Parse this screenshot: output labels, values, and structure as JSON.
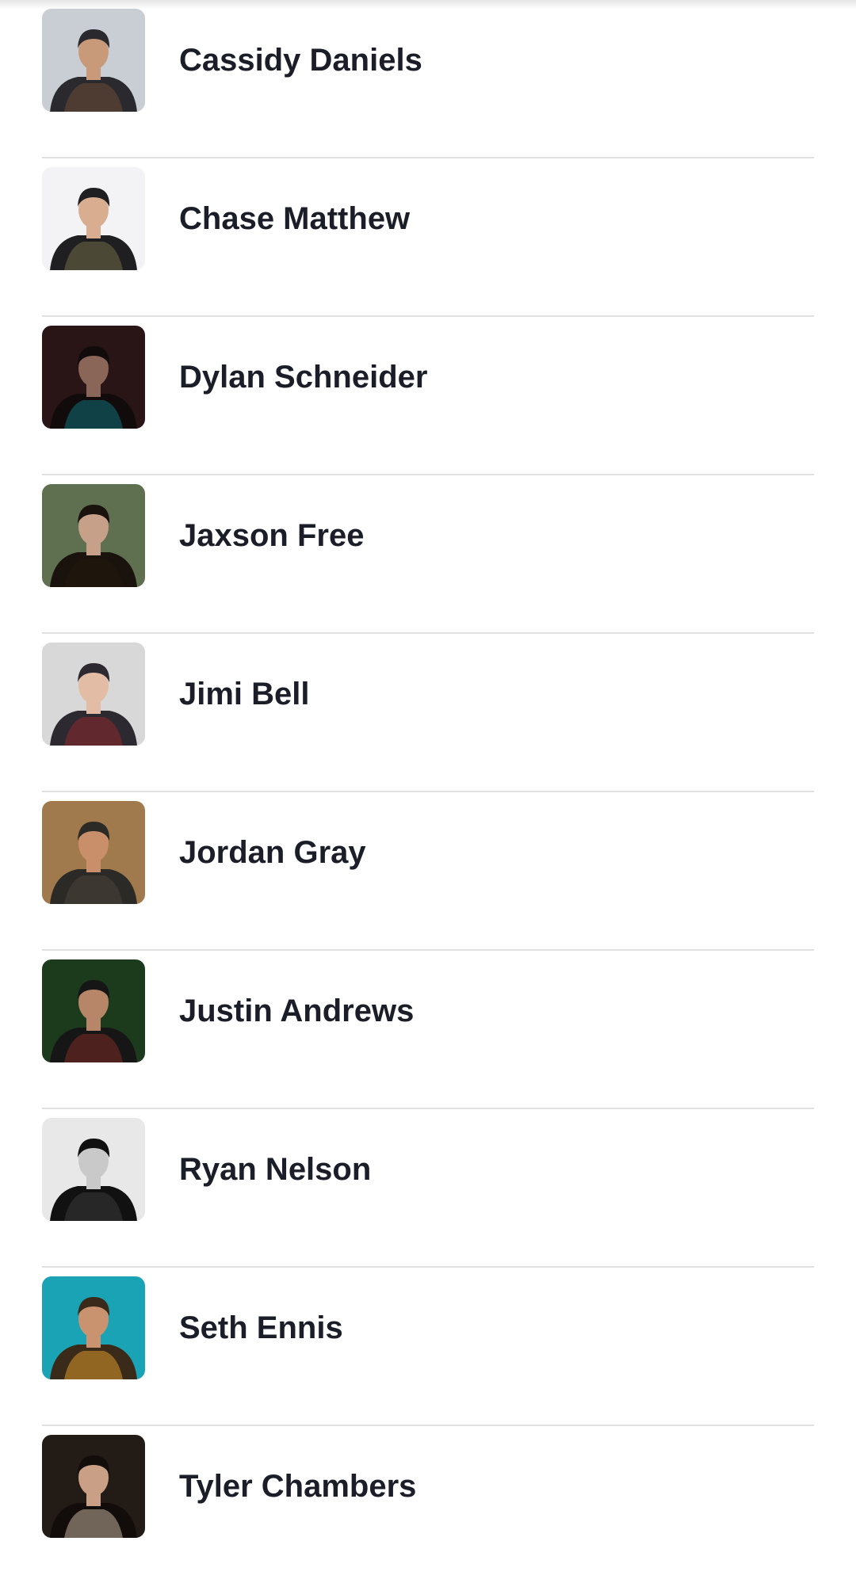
{
  "artists": [
    {
      "name": "Cassidy Daniels",
      "photo": {
        "bg": "#c9cdd4",
        "accent": "#6b4a36",
        "skin": "#c89a7a",
        "dark": "#2a2a2e"
      }
    },
    {
      "name": "Chase Matthew",
      "photo": {
        "bg": "#f3f3f6",
        "accent": "#6f6a45",
        "skin": "#d9ad90",
        "dark": "#1f1f22"
      }
    },
    {
      "name": "Dylan Schneider",
      "photo": {
        "bg": "#2a1516",
        "accent": "#0f6f78",
        "skin": "#8a6658",
        "dark": "#120b0c"
      }
    },
    {
      "name": "Jaxson Free",
      "photo": {
        "bg": "#5f7050",
        "accent": "#23170f",
        "skin": "#c7a08a",
        "dark": "#1a120d"
      }
    },
    {
      "name": "Jimi Bell",
      "photo": {
        "bg": "#d8d8d8",
        "accent": "#8e2a2c",
        "skin": "#e2bca5",
        "dark": "#2c2930"
      }
    },
    {
      "name": "Jordan Gray",
      "photo": {
        "bg": "#a07a4c",
        "accent": "#4a4238",
        "skin": "#c98f6a",
        "dark": "#2b2a27"
      }
    },
    {
      "name": "Justin Andrews",
      "photo": {
        "bg": "#1c3a1c",
        "accent": "#7c2b24",
        "skin": "#b78668",
        "dark": "#161616"
      }
    },
    {
      "name": "Ryan Nelson",
      "photo": {
        "bg": "#e8e8e8",
        "accent": "#3b3b3b",
        "skin": "#c9c9c9",
        "dark": "#111111"
      }
    },
    {
      "name": "Seth Ennis",
      "photo": {
        "bg": "#1aa3b5",
        "accent": "#d8982a",
        "skin": "#c9936f",
        "dark": "#3a2a1a"
      }
    },
    {
      "name": "Tyler Chambers",
      "photo": {
        "bg": "#231b16",
        "accent": "#bfae9a",
        "skin": "#c9a085",
        "dark": "#120d0a"
      }
    }
  ]
}
